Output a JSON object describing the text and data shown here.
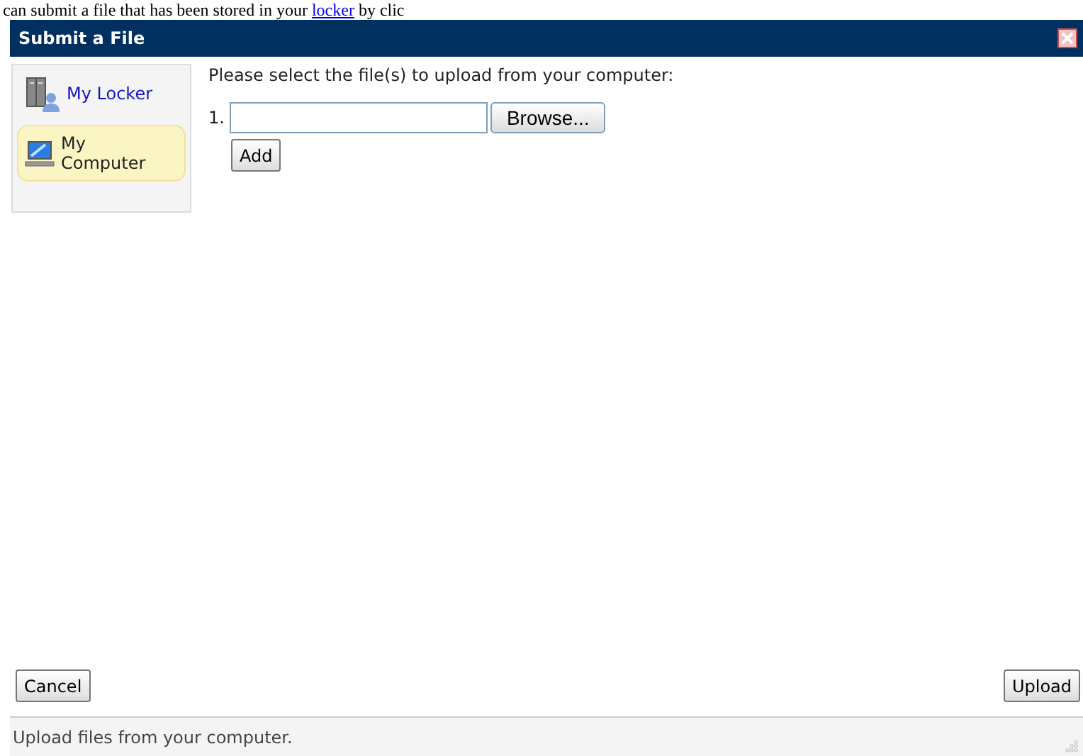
{
  "background_text": {
    "before": "can submit a file that has been stored in your ",
    "link": "locker",
    "after": " by clic"
  },
  "window": {
    "title": "Submit a File"
  },
  "sidebar": {
    "items": [
      {
        "label": "My Locker",
        "kind": "locker",
        "selected": false
      },
      {
        "label": "My Computer",
        "kind": "computer",
        "selected": true
      }
    ]
  },
  "content": {
    "instruction": "Please select the file(s) to upload from your computer:",
    "files": [
      {
        "number": "1.",
        "browse": "Browse..."
      }
    ],
    "add_button": "Add"
  },
  "buttons": {
    "cancel": "Cancel",
    "upload": "Upload"
  },
  "status_bar": "Upload files from your computer."
}
